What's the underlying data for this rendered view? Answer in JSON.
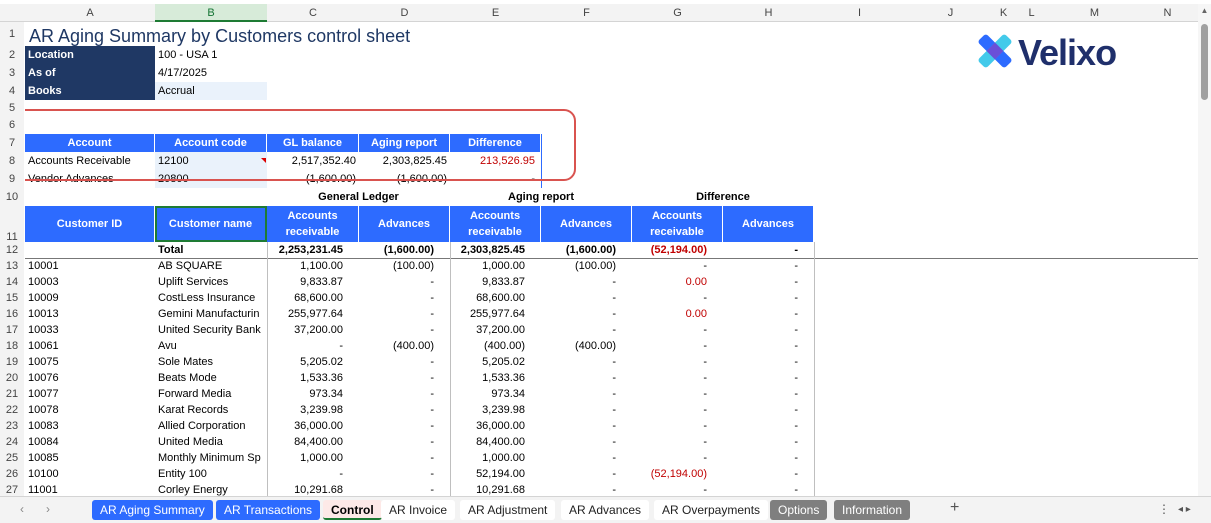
{
  "columns": [
    "A",
    "B",
    "C",
    "D",
    "E",
    "F",
    "G",
    "H",
    "I",
    "J",
    "K",
    "L",
    "M",
    "N"
  ],
  "rows": [
    "1",
    "2",
    "3",
    "4",
    "5",
    "6",
    "7",
    "8",
    "9",
    "10",
    "11",
    "12",
    "13",
    "14",
    "15",
    "16",
    "17",
    "18",
    "19",
    "20",
    "21",
    "22",
    "23",
    "24",
    "25",
    "26",
    "27"
  ],
  "title": "AR Aging Summary by Customers control sheet",
  "logo_text": "Velixo",
  "params": [
    {
      "label": "Location",
      "value": "100 - USA 1"
    },
    {
      "label": "As of",
      "value": "4/17/2025"
    },
    {
      "label": "Books",
      "value": "Accrual"
    }
  ],
  "control_table": {
    "headers": [
      "Account",
      "Account code",
      "GL balance",
      "Aging report",
      "Difference"
    ],
    "rows": [
      [
        "Accounts Receivable",
        "12100",
        "2,517,352.40",
        "2,303,825.45",
        "213,526.95"
      ],
      [
        "Vendor Advances",
        "20800",
        "(1,600.00)",
        "(1,600.00)",
        "-"
      ]
    ]
  },
  "group_headers": [
    "General Ledger",
    "Aging report",
    "Difference"
  ],
  "main_headers": [
    "Customer ID",
    "Customer name",
    "Accounts receivable",
    "Advances",
    "Accounts receivable",
    "Advances",
    "Accounts receivable",
    "Advances"
  ],
  "total_row": [
    "",
    "Total",
    "2,253,231.45",
    "(1,600.00)",
    "2,303,825.45",
    "(1,600.00)",
    "(52,194.00)",
    "-"
  ],
  "data_rows": [
    [
      "10001",
      "AB SQUARE",
      "1,100.00",
      "(100.00)",
      "1,000.00",
      "(100.00)",
      "-",
      "-"
    ],
    [
      "10003",
      "Uplift Services",
      "9,833.87",
      "-",
      "9,833.87",
      "-",
      "0.00",
      "-"
    ],
    [
      "10009",
      "CostLess Insurance",
      "68,600.00",
      "-",
      "68,600.00",
      "-",
      "-",
      "-"
    ],
    [
      "10013",
      "Gemini Manufacturin",
      "255,977.64",
      "-",
      "255,977.64",
      "-",
      "0.00",
      "-"
    ],
    [
      "10033",
      "United Security Bank",
      "37,200.00",
      "-",
      "37,200.00",
      "-",
      "-",
      "-"
    ],
    [
      "10061",
      "Avu",
      "-",
      "(400.00)",
      "(400.00)",
      "(400.00)",
      "-",
      "-"
    ],
    [
      "10075",
      "Sole Mates",
      "5,205.02",
      "-",
      "5,205.02",
      "-",
      "-",
      "-"
    ],
    [
      "10076",
      "Beats Mode",
      "1,533.36",
      "-",
      "1,533.36",
      "-",
      "-",
      "-"
    ],
    [
      "10077",
      "Forward Media",
      "973.34",
      "-",
      "973.34",
      "-",
      "-",
      "-"
    ],
    [
      "10078",
      "Karat Records",
      "3,239.98",
      "-",
      "3,239.98",
      "-",
      "-",
      "-"
    ],
    [
      "10083",
      "Allied Corporation",
      "36,000.00",
      "-",
      "36,000.00",
      "-",
      "-",
      "-"
    ],
    [
      "10084",
      "United Media",
      "84,400.00",
      "-",
      "84,400.00",
      "-",
      "-",
      "-"
    ],
    [
      "10085",
      "Monthly Minimum Sp",
      "1,000.00",
      "-",
      "1,000.00",
      "-",
      "-",
      "-"
    ],
    [
      "10100",
      "Entity 100",
      "-",
      "-",
      "52,194.00",
      "-",
      "(52,194.00)",
      "-"
    ],
    [
      "11001",
      "Corley Energy",
      "10,291.68",
      "-",
      "10,291.68",
      "-",
      "-",
      "-"
    ]
  ],
  "tabs": [
    "AR Aging Summary",
    "AR Transactions",
    "Control",
    "AR Invoice",
    "AR Adjustment",
    "AR Advances",
    "AR Overpayments",
    "Options",
    "Information"
  ],
  "add_sheet": "+",
  "colors": {
    "navy": "#1f3864",
    "blue": "#2d6bff",
    "red": "#c00000",
    "highlight": "#d9534f"
  }
}
